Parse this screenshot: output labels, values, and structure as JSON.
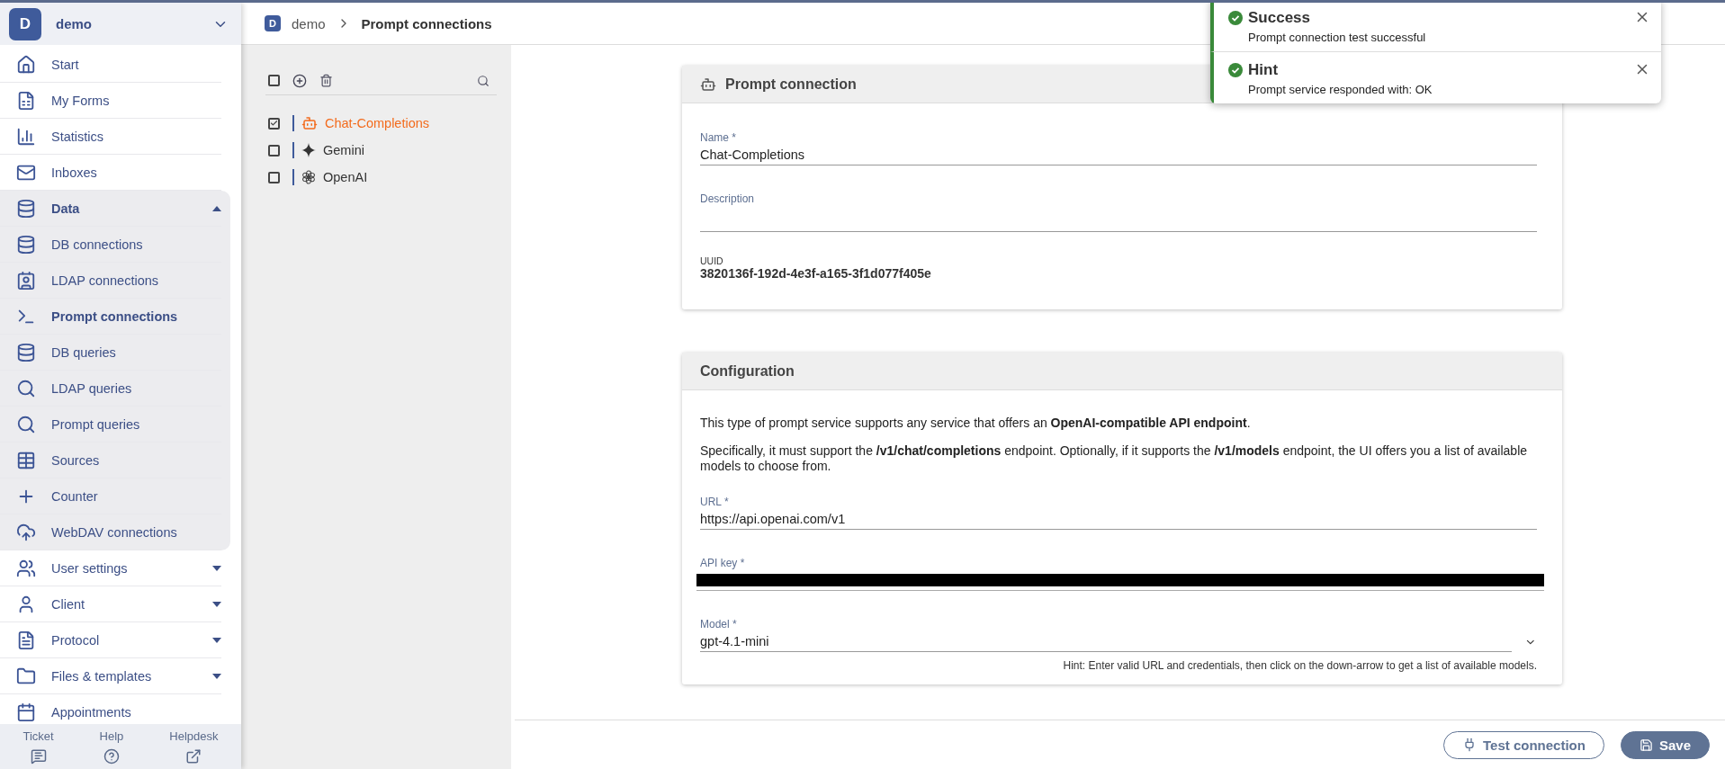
{
  "workspace": {
    "initial": "D",
    "name": "demo"
  },
  "sidebar": {
    "items": [
      {
        "kind": "link",
        "label": "Start",
        "selected": false
      },
      {
        "kind": "link",
        "label": "My Forms",
        "selected": false
      },
      {
        "kind": "link",
        "label": "Statistics",
        "selected": false
      },
      {
        "kind": "link",
        "label": "Inboxes",
        "selected": false
      },
      {
        "kind": "group",
        "label": "Data",
        "expanded": true,
        "children": [
          {
            "kind": "link",
            "label": "DB connections",
            "selected": false
          },
          {
            "kind": "link",
            "label": "LDAP connections",
            "selected": false
          },
          {
            "kind": "link",
            "label": "Prompt connections",
            "selected": true
          },
          {
            "kind": "link",
            "label": "DB queries",
            "selected": false
          },
          {
            "kind": "link",
            "label": "LDAP queries",
            "selected": false
          },
          {
            "kind": "link",
            "label": "Prompt queries",
            "selected": false
          },
          {
            "kind": "link",
            "label": "Sources",
            "selected": false
          },
          {
            "kind": "link",
            "label": "Counter",
            "selected": false
          },
          {
            "kind": "link",
            "label": "WebDAV connections",
            "selected": false
          }
        ]
      },
      {
        "kind": "group",
        "label": "User settings",
        "expanded": false
      },
      {
        "kind": "group",
        "label": "Client",
        "expanded": false
      },
      {
        "kind": "group",
        "label": "Protocol",
        "expanded": false
      },
      {
        "kind": "group",
        "label": "Files & templates",
        "expanded": false
      },
      {
        "kind": "link",
        "label": "Appointments",
        "selected": false
      }
    ]
  },
  "footer_links": [
    {
      "label": "Ticket"
    },
    {
      "label": "Help"
    },
    {
      "label": "Helpdesk"
    }
  ],
  "breadcrumb": {
    "initial": "D",
    "items": [
      "demo",
      "Prompt connections"
    ]
  },
  "list": {
    "select_all": {
      "checked": false
    },
    "items": [
      {
        "kind": "robot",
        "label": "Chat-Completions",
        "checked": true,
        "selected": true
      },
      {
        "kind": "sparkle",
        "label": "Gemini",
        "checked": false,
        "selected": false
      },
      {
        "kind": "knot",
        "label": "OpenAI",
        "checked": false,
        "selected": false
      }
    ]
  },
  "connection_card": {
    "title": "Prompt connection",
    "name": {
      "label": "Name *",
      "value": "Chat-Completions"
    },
    "description": {
      "label": "Description"
    },
    "uuid": {
      "label": "UUID",
      "value": "3820136f-192d-4e3f-a165-3f1d077f405e"
    }
  },
  "configuration_card": {
    "title": "Configuration",
    "paragraphs": [
      "This type of prompt service supports any service that offers an **OpenAI-compatible API endpoint**.",
      "Specifically, it must support the **/v1/chat/completions** endpoint. Optionally, if it supports the **/v1/models** endpoint, the UI offers you a list of available models to choose from."
    ],
    "url": {
      "label": "URL *",
      "value": "https://api.openai.com/v1"
    },
    "api_key": {
      "label": "API key *",
      "redacted": true
    },
    "model": {
      "label": "Model *",
      "value": "gpt-4.1-mini"
    },
    "hint": "Hint: Enter valid URL and credentials, then click on the down-arrow to get a list of available models."
  },
  "actions": [
    {
      "kind": "outline",
      "label": "Test connection"
    },
    {
      "kind": "primary",
      "label": "Save"
    }
  ],
  "toasts": [
    {
      "title": "Success",
      "message": "Prompt connection test successful"
    },
    {
      "title": "Hint",
      "message": "Prompt service responded with: OK"
    }
  ]
}
